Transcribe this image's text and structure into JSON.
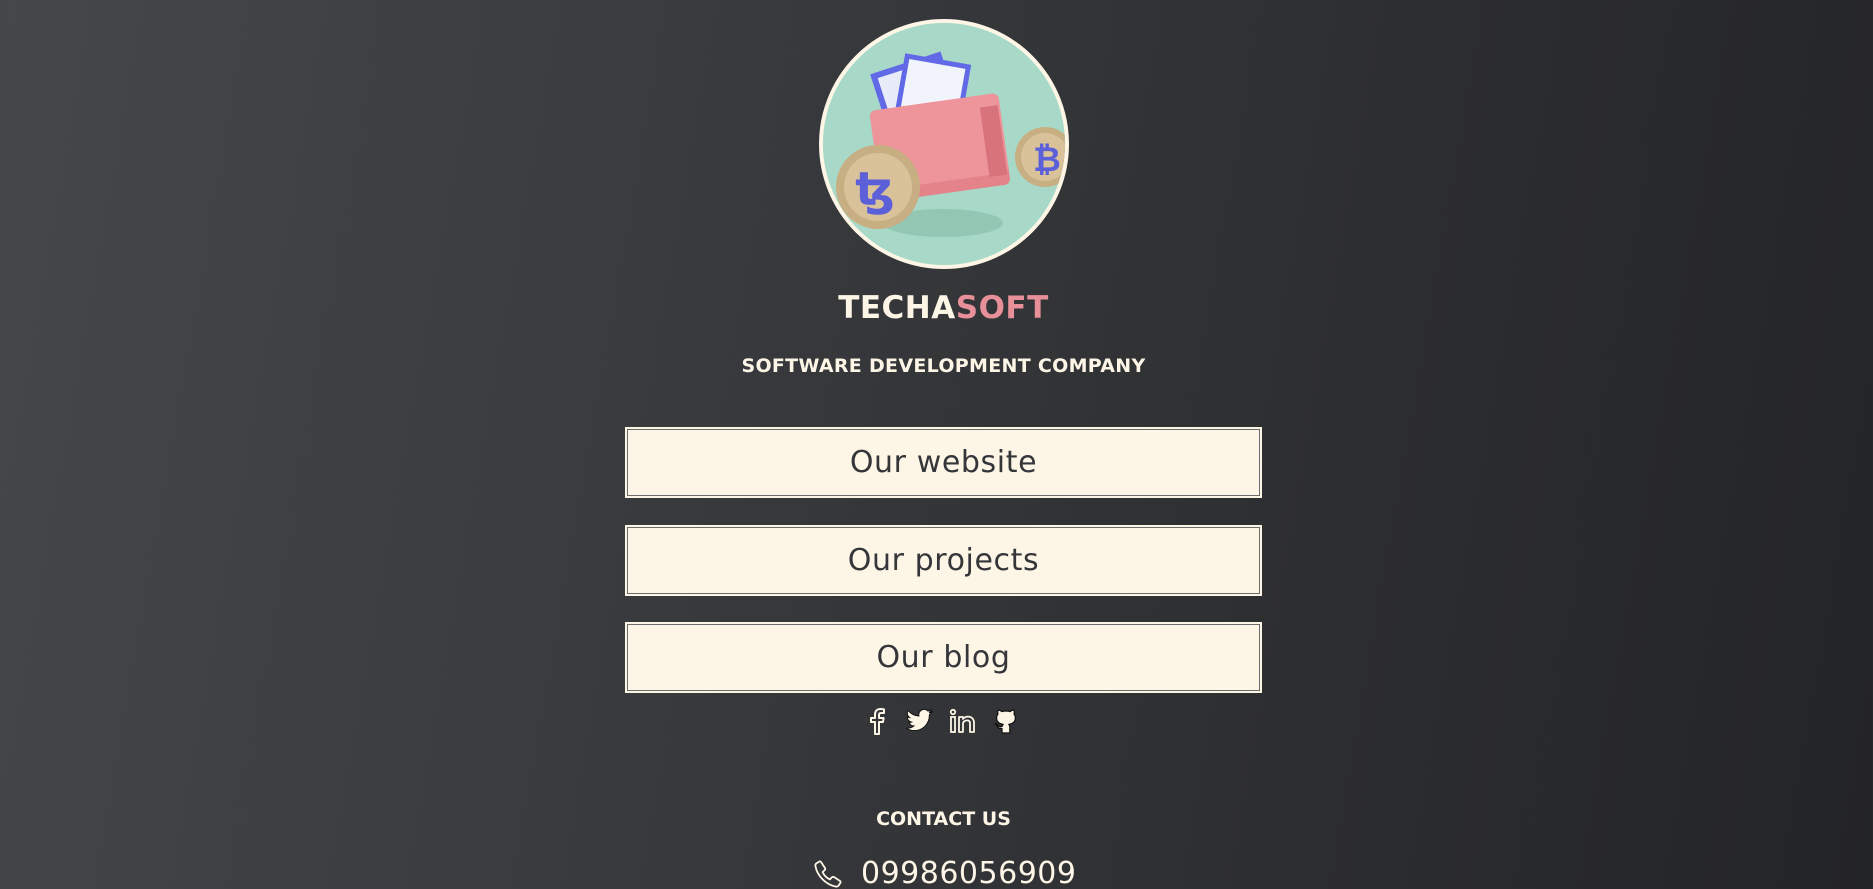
{
  "brand": {
    "name_part1": "TECHA",
    "name_part2": "SOFT",
    "tagline": "SOFTWARE DEVELOPMENT COMPANY"
  },
  "links": [
    {
      "label": "Our website"
    },
    {
      "label": "Our projects"
    },
    {
      "label": "Our blog"
    }
  ],
  "social": [
    "facebook-icon",
    "twitter-icon",
    "linkedin-icon",
    "github-icon"
  ],
  "contact": {
    "title": "CONTACT US",
    "phone": "09986056909"
  },
  "colors": {
    "cream": "#fdf5e6",
    "accent_pink": "#e8909a",
    "button_text": "#34363a",
    "avatar_bg": "#a8d9c8"
  }
}
